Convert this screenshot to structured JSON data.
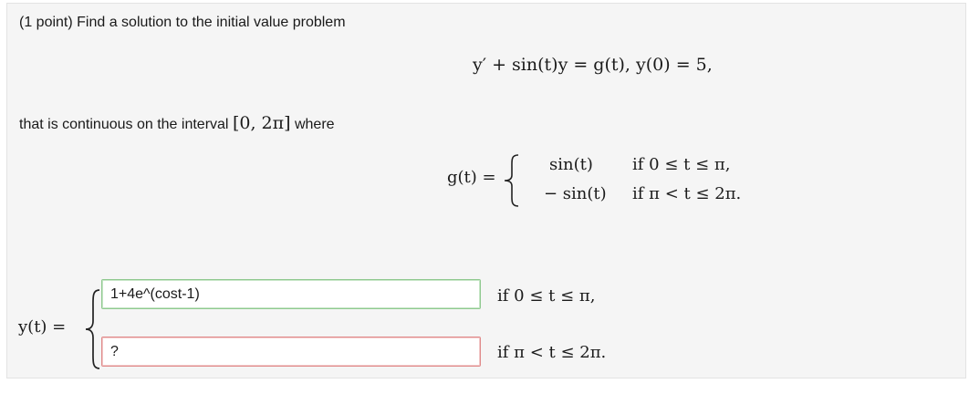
{
  "problem": {
    "prompt": "(1 point) Find a solution to the initial value problem",
    "equation": "y′ + sin(t)y = g(t),   y(0) = 5,",
    "continuity_text": "that is continuous on the interval",
    "interval": "[0, 2π]",
    "where_text": "where"
  },
  "g_definition": {
    "lhs": "g(t) =",
    "case1_value": "sin(t)",
    "case1_condition": "if 0 ≤ t ≤ π,",
    "case2_value": "− sin(t)",
    "case2_condition": "if π < t ≤ 2π."
  },
  "answer": {
    "lhs": "y(t) =",
    "field1_value": "1+4e^(cost-1)",
    "field1_condition": "if 0 ≤ t ≤ π,",
    "field1_status": "correct",
    "field2_value": "?",
    "field2_condition": "if π < t ≤ 2π.",
    "field2_status": "incorrect"
  },
  "colors": {
    "panel_bg": "#f5f5f5",
    "correct_border": "#8fc98f",
    "incorrect_border": "#e08a8a"
  }
}
